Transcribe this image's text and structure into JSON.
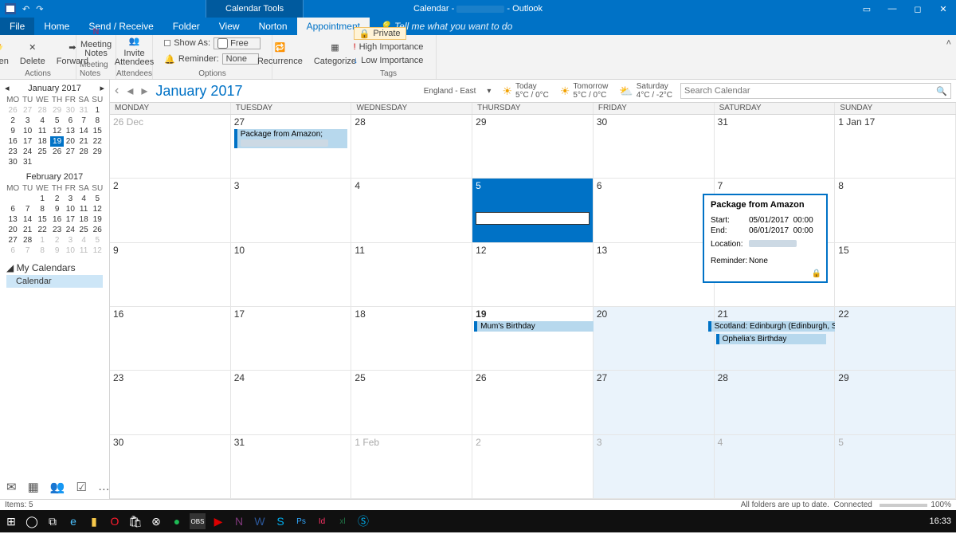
{
  "titlebar": {
    "context_tab": "Calendar Tools",
    "title_left": "Calendar -",
    "title_right": "-   Outlook"
  },
  "tabs": {
    "file": "File",
    "home": "Home",
    "sendreceive": "Send / Receive",
    "folder": "Folder",
    "view": "View",
    "norton": "Norton",
    "appointment": "Appointment",
    "tell_me": "Tell me what you want to do"
  },
  "ribbon": {
    "open": "Open",
    "delete": "Delete",
    "forward": "Forward",
    "meeting_notes": "Meeting\nNotes",
    "invite_attendees": "Invite\nAttendees",
    "show_as_label": "Show As:",
    "show_as_value": "Free",
    "reminder_label": "Reminder:",
    "reminder_value": "None",
    "recurrence": "Recurrence",
    "categorize": "Categorize",
    "private": "Private",
    "high_importance": "High Importance",
    "low_importance": "Low Importance",
    "g_actions": "Actions",
    "g_meeting_notes": "Meeting Notes",
    "g_attendees": "Attendees",
    "g_options": "Options",
    "g_tags": "Tags"
  },
  "minical1": {
    "title": "January 2017",
    "dow": [
      "MO",
      "TU",
      "WE",
      "TH",
      "FR",
      "SA",
      "SU"
    ],
    "rows": [
      [
        {
          "d": "26",
          "dim": true
        },
        {
          "d": "27",
          "dim": true
        },
        {
          "d": "28",
          "dim": true
        },
        {
          "d": "29",
          "dim": true
        },
        {
          "d": "30",
          "dim": true
        },
        {
          "d": "31",
          "dim": true
        },
        {
          "d": "1"
        }
      ],
      [
        {
          "d": "2"
        },
        {
          "d": "3"
        },
        {
          "d": "4"
        },
        {
          "d": "5"
        },
        {
          "d": "6"
        },
        {
          "d": "7"
        },
        {
          "d": "8"
        }
      ],
      [
        {
          "d": "9"
        },
        {
          "d": "10"
        },
        {
          "d": "11"
        },
        {
          "d": "12"
        },
        {
          "d": "13"
        },
        {
          "d": "14"
        },
        {
          "d": "15"
        }
      ],
      [
        {
          "d": "16"
        },
        {
          "d": "17"
        },
        {
          "d": "18"
        },
        {
          "d": "19",
          "sel": true
        },
        {
          "d": "20"
        },
        {
          "d": "21"
        },
        {
          "d": "22"
        }
      ],
      [
        {
          "d": "23"
        },
        {
          "d": "24"
        },
        {
          "d": "25"
        },
        {
          "d": "26"
        },
        {
          "d": "27"
        },
        {
          "d": "28"
        },
        {
          "d": "29"
        }
      ],
      [
        {
          "d": "30"
        },
        {
          "d": "31"
        },
        {
          "d": "",
          "dim": true
        },
        {
          "d": "",
          "dim": true
        },
        {
          "d": "",
          "dim": true
        },
        {
          "d": "",
          "dim": true
        },
        {
          "d": "",
          "dim": true
        }
      ]
    ]
  },
  "minical2": {
    "title": "February 2017",
    "rows": [
      [
        {
          "d": "",
          "dim": true
        },
        {
          "d": "",
          "dim": true
        },
        {
          "d": "1"
        },
        {
          "d": "2"
        },
        {
          "d": "3"
        },
        {
          "d": "4"
        },
        {
          "d": "5"
        }
      ],
      [
        {
          "d": "6"
        },
        {
          "d": "7"
        },
        {
          "d": "8"
        },
        {
          "d": "9"
        },
        {
          "d": "10"
        },
        {
          "d": "11"
        },
        {
          "d": "12"
        }
      ],
      [
        {
          "d": "13"
        },
        {
          "d": "14"
        },
        {
          "d": "15"
        },
        {
          "d": "16"
        },
        {
          "d": "17"
        },
        {
          "d": "18"
        },
        {
          "d": "19"
        }
      ],
      [
        {
          "d": "20"
        },
        {
          "d": "21"
        },
        {
          "d": "22"
        },
        {
          "d": "23"
        },
        {
          "d": "24"
        },
        {
          "d": "25"
        },
        {
          "d": "26"
        }
      ],
      [
        {
          "d": "27"
        },
        {
          "d": "28"
        },
        {
          "d": "1",
          "dim": true
        },
        {
          "d": "2",
          "dim": true
        },
        {
          "d": "3",
          "dim": true
        },
        {
          "d": "4",
          "dim": true
        },
        {
          "d": "5",
          "dim": true
        }
      ],
      [
        {
          "d": "6",
          "dim": true
        },
        {
          "d": "7",
          "dim": true
        },
        {
          "d": "8",
          "dim": true
        },
        {
          "d": "9",
          "dim": true
        },
        {
          "d": "10",
          "dim": true
        },
        {
          "d": "11",
          "dim": true
        },
        {
          "d": "12",
          "dim": true
        }
      ]
    ]
  },
  "sidebar": {
    "my_calendars": "My Calendars",
    "calendar_item": "Calendar"
  },
  "calhead": {
    "month": "January 2017",
    "location": "England - East",
    "today_lbl": "Today",
    "today_temp": "5°C / 0°C",
    "tomorrow_lbl": "Tomorrow",
    "tomorrow_temp": "5°C / 0°C",
    "sat_lbl": "Saturday",
    "sat_temp": "4°C / -2°C",
    "search_placeholder": "Search Calendar"
  },
  "dayheaders": [
    "MONDAY",
    "TUESDAY",
    "WEDNESDAY",
    "THURSDAY",
    "FRIDAY",
    "SATURDAY",
    "SUNDAY"
  ],
  "grid": {
    "labels": [
      "26 Dec",
      "27",
      "28",
      "29",
      "30",
      "31",
      "1 Jan 17",
      "2",
      "3",
      "4",
      "5",
      "6",
      "7",
      "8",
      "9",
      "10",
      "11",
      "12",
      "13",
      "14",
      "15",
      "16",
      "17",
      "18",
      "19",
      "20",
      "21",
      "22",
      "23",
      "24",
      "25",
      "26",
      "27",
      "28",
      "29",
      "30",
      "31",
      "1 Feb",
      "2",
      "3",
      "4",
      "5"
    ]
  },
  "events": {
    "amazon": "Package from Amazon;",
    "mum": "Mum's Birthday",
    "scotland": "Scotland: Edinburgh (Edinburgh, Scotland, United Kingdom)",
    "ophelia": "Ophelia's Birthday"
  },
  "popup": {
    "title": "Package from Amazon",
    "start_k": "Start:",
    "start_d": "05/01/2017",
    "start_t": "00:00",
    "end_k": "End:",
    "end_d": "06/01/2017",
    "end_t": "00:00",
    "loc_k": "Location:",
    "rem_k": "Reminder:",
    "rem_v": "None"
  },
  "itemsbar": {
    "items": "Items: 5",
    "uptodate": "All folders are up to date.",
    "connected": "Connected",
    "zoom": "100%"
  },
  "taskbar": {
    "clock": "16:33"
  }
}
